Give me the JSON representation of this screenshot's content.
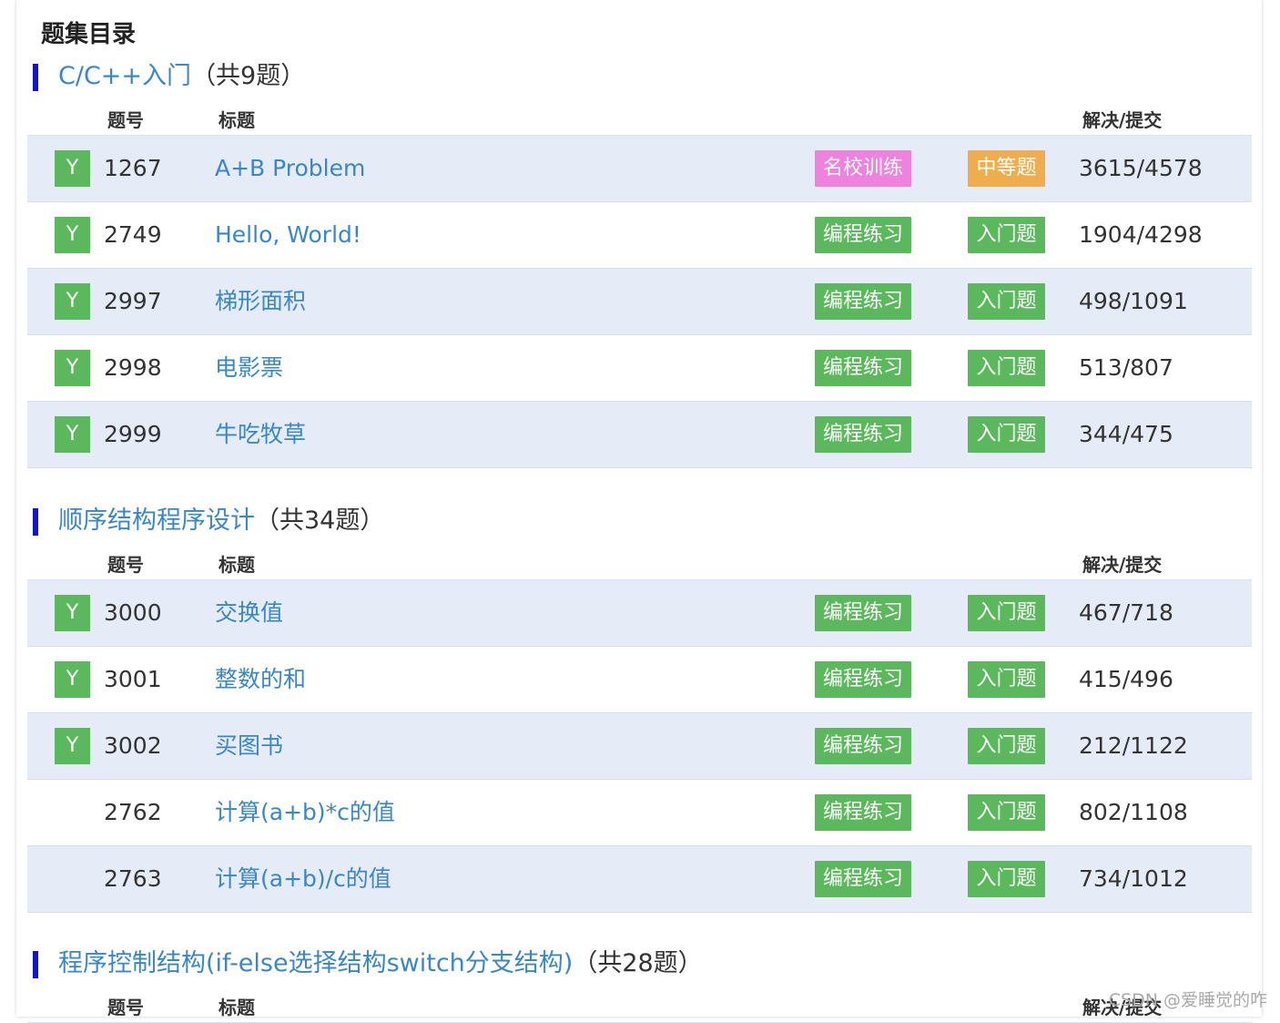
{
  "page_title": "题集目录",
  "columns": {
    "id": "题号",
    "title": "标题",
    "ratio": "解决/提交"
  },
  "colors": {
    "section_title": "#3a87c8",
    "section_bar": "#1515c8",
    "solved_mark": "#5cb85c",
    "tag_green": "#5cb85c",
    "tag_pink": "#ee82dd",
    "tag_orange": "#f0ad4e",
    "row_alt": "#e5ebf7"
  },
  "sections": [
    {
      "name": "C/C++入门",
      "count_label": "（共9题）",
      "problems": [
        {
          "solved": "Y",
          "id": "1267",
          "title": "A+B Problem",
          "source_tag": "名校训练",
          "source_color": "#ee82dd",
          "level_tag": "中等题",
          "level_color": "#f0ad4e",
          "ratio": "3615/4578"
        },
        {
          "solved": "Y",
          "id": "2749",
          "title": "Hello, World!",
          "source_tag": "编程练习",
          "source_color": "#5cb85c",
          "level_tag": "入门题",
          "level_color": "#5cb85c",
          "ratio": "1904/4298"
        },
        {
          "solved": "Y",
          "id": "2997",
          "title": "梯形面积",
          "source_tag": "编程练习",
          "source_color": "#5cb85c",
          "level_tag": "入门题",
          "level_color": "#5cb85c",
          "ratio": "498/1091"
        },
        {
          "solved": "Y",
          "id": "2998",
          "title": "电影票",
          "source_tag": "编程练习",
          "source_color": "#5cb85c",
          "level_tag": "入门题",
          "level_color": "#5cb85c",
          "ratio": "513/807"
        },
        {
          "solved": "Y",
          "id": "2999",
          "title": "牛吃牧草",
          "source_tag": "编程练习",
          "source_color": "#5cb85c",
          "level_tag": "入门题",
          "level_color": "#5cb85c",
          "ratio": "344/475"
        }
      ]
    },
    {
      "name": "顺序结构程序设计",
      "count_label": "（共34题）",
      "problems": [
        {
          "solved": "Y",
          "id": "3000",
          "title": "交换值",
          "source_tag": "编程练习",
          "source_color": "#5cb85c",
          "level_tag": "入门题",
          "level_color": "#5cb85c",
          "ratio": "467/718"
        },
        {
          "solved": "Y",
          "id": "3001",
          "title": "整数的和",
          "source_tag": "编程练习",
          "source_color": "#5cb85c",
          "level_tag": "入门题",
          "level_color": "#5cb85c",
          "ratio": "415/496"
        },
        {
          "solved": "Y",
          "id": "3002",
          "title": "买图书",
          "source_tag": "编程练习",
          "source_color": "#5cb85c",
          "level_tag": "入门题",
          "level_color": "#5cb85c",
          "ratio": "212/1122"
        },
        {
          "solved": "",
          "id": "2762",
          "title": "计算(a+b)*c的值",
          "source_tag": "编程练习",
          "source_color": "#5cb85c",
          "level_tag": "入门题",
          "level_color": "#5cb85c",
          "ratio": "802/1108"
        },
        {
          "solved": "",
          "id": "2763",
          "title": "计算(a+b)/c的值",
          "source_tag": "编程练习",
          "source_color": "#5cb85c",
          "level_tag": "入门题",
          "level_color": "#5cb85c",
          "ratio": "734/1012"
        }
      ]
    },
    {
      "name": "程序控制结构(if-else选择结构switch分支结构)",
      "count_label": "（共28题）",
      "problems": []
    }
  ],
  "watermark": "CSDN @爱睡觉的咋"
}
